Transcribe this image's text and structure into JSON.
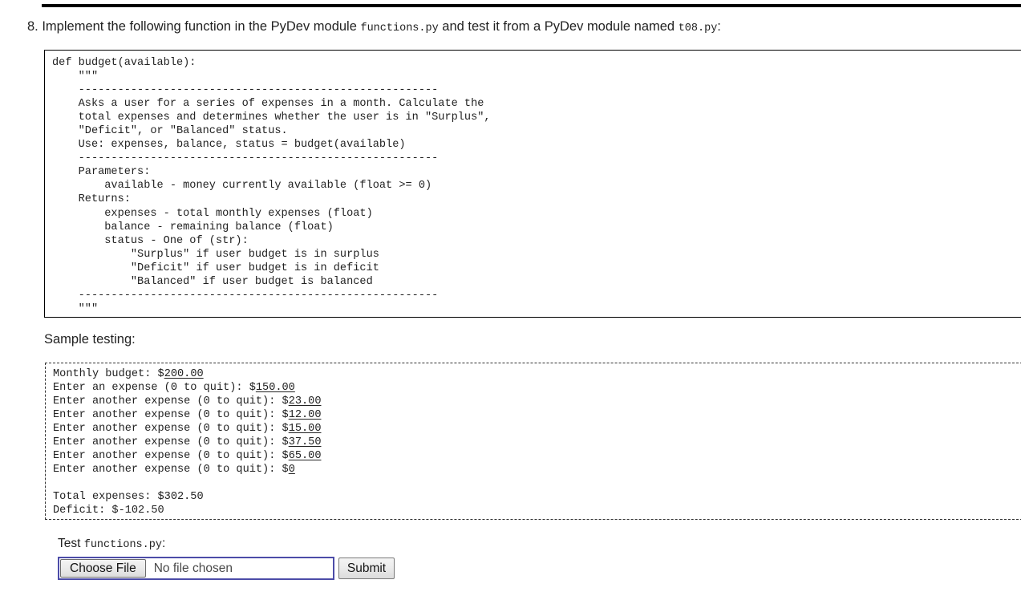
{
  "page": {
    "question_number": "8.",
    "question_text_1": " Implement the following function in the PyDev module ",
    "question_code_1": "functions.py",
    "question_text_2": " and test it from a PyDev module named ",
    "question_code_2": "t08.py",
    "question_text_3": ":",
    "sample_testing_label": "Sample testing:",
    "test_label_text": "Test ",
    "test_label_code": "functions.py",
    "test_label_colon": ":"
  },
  "code_block": {
    "content": "def budget(available):\n    \"\"\"\n    -------------------------------------------------------\n    Asks a user for a series of expenses in a month. Calculate the\n    total expenses and determines whether the user is in \"Surplus\",\n    \"Deficit\", or \"Balanced\" status.\n    Use: expenses, balance, status = budget(available)\n    -------------------------------------------------------\n    Parameters:\n        available - money currently available (float >= 0)\n    Returns:\n        expenses - total monthly expenses (float)\n        balance - remaining balance (float)\n        status - One of (str):\n            \"Surplus\" if user budget is in surplus\n            \"Deficit\" if user budget is in deficit\n            \"Balanced\" if user budget is balanced\n    -------------------------------------------------------\n    \"\"\""
  },
  "sample_output": {
    "lines": [
      {
        "prompt": "Monthly budget: $",
        "input": "200.00"
      },
      {
        "prompt": "Enter an expense (0 to quit): $",
        "input": "150.00"
      },
      {
        "prompt": "Enter another expense (0 to quit): $",
        "input": "23.00"
      },
      {
        "prompt": "Enter another expense (0 to quit): $",
        "input": "12.00"
      },
      {
        "prompt": "Enter another expense (0 to quit): $",
        "input": "15.00"
      },
      {
        "prompt": "Enter another expense (0 to quit): $",
        "input": "37.50"
      },
      {
        "prompt": "Enter another expense (0 to quit): $",
        "input": "65.00"
      },
      {
        "prompt": "Enter another expense (0 to quit): $",
        "input": "0"
      },
      {
        "prompt": "",
        "input": ""
      },
      {
        "prompt": "Total expenses: $302.50",
        "input": ""
      },
      {
        "prompt": "Deficit: $-102.50",
        "input": ""
      }
    ]
  },
  "form": {
    "choose_file_label": "Choose File",
    "file_name_text": "No file chosen",
    "submit_label": "Submit"
  },
  "colors": {
    "text": "#222222",
    "rule": "#000000",
    "code_border": "#000000",
    "sample_border": "#333333",
    "file_focus_ring": "#4c4ca8",
    "button_face": "#ececec"
  }
}
